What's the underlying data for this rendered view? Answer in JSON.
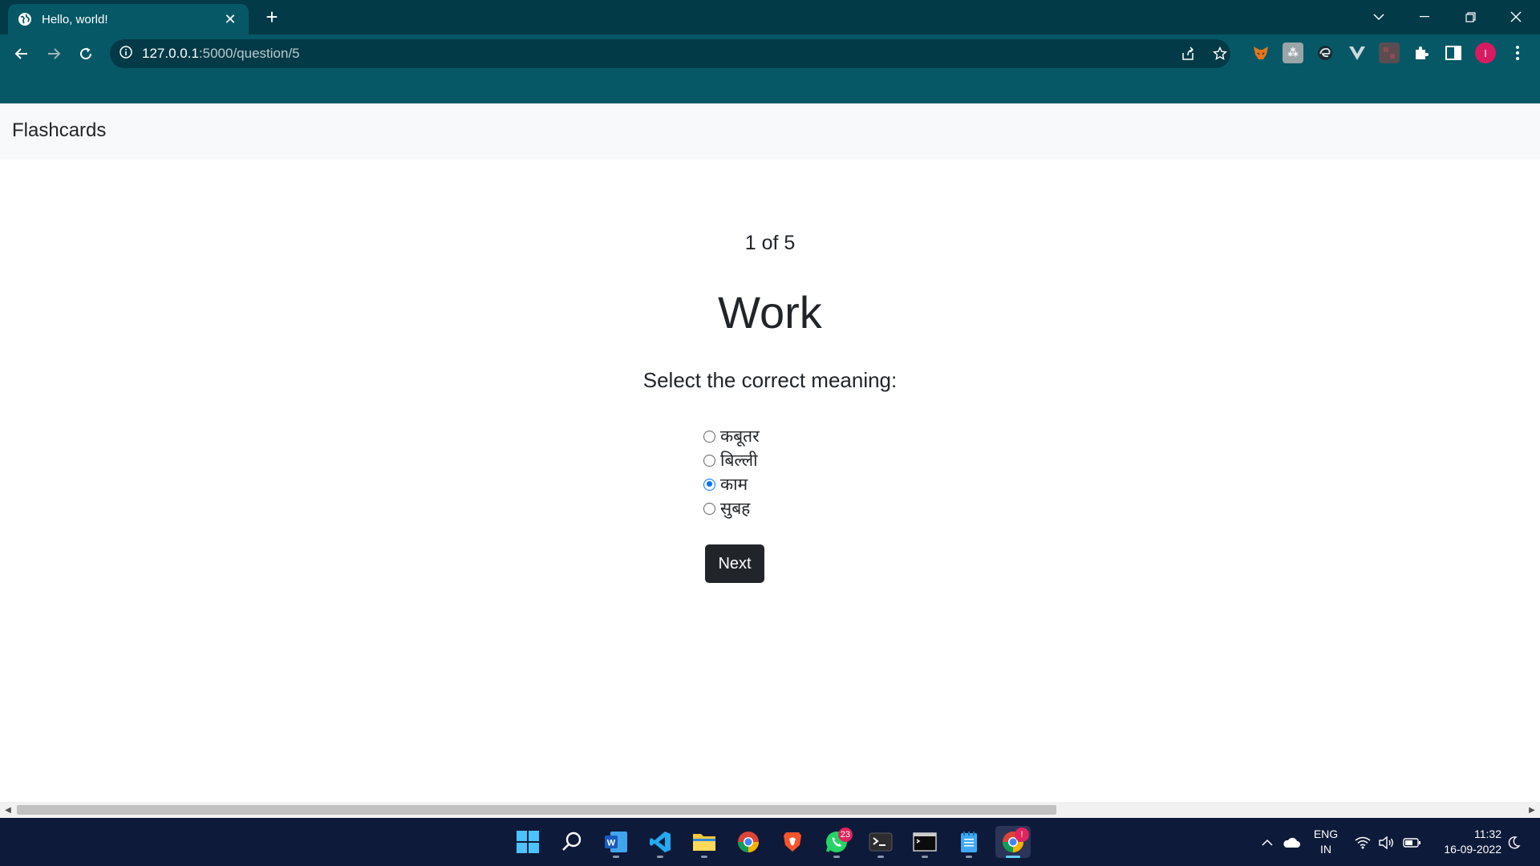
{
  "browser": {
    "tab_title": "Hello, world!",
    "url_host": "127.0.0.1",
    "url_rest": ":5000/question/5",
    "profile_initial": "I"
  },
  "page": {
    "brand": "Flashcards",
    "counter": "1 of 5",
    "word": "Work",
    "prompt": "Select the correct meaning:",
    "options": [
      {
        "label": "कबूतर",
        "checked": false
      },
      {
        "label": "बिल्ली",
        "checked": false
      },
      {
        "label": "काम",
        "checked": true
      },
      {
        "label": "सुबह",
        "checked": false
      }
    ],
    "next_label": "Next"
  },
  "taskbar": {
    "apps": [
      "start",
      "search",
      "word",
      "vscode",
      "file-explorer",
      "chrome",
      "brave",
      "whatsapp",
      "terminal",
      "command-prompt",
      "notepad",
      "chrome-active"
    ],
    "whatsapp_badge": "23",
    "chrome_badge": "!",
    "lang_top": "ENG",
    "lang_bottom": "IN",
    "time": "11:32",
    "date": "16-09-2022"
  },
  "colors": {
    "titlebar": "#033a47",
    "toolbar": "#065866",
    "taskbar": "#0e1a3a",
    "next_button": "#212529",
    "radio_accent": "#0075ff"
  }
}
